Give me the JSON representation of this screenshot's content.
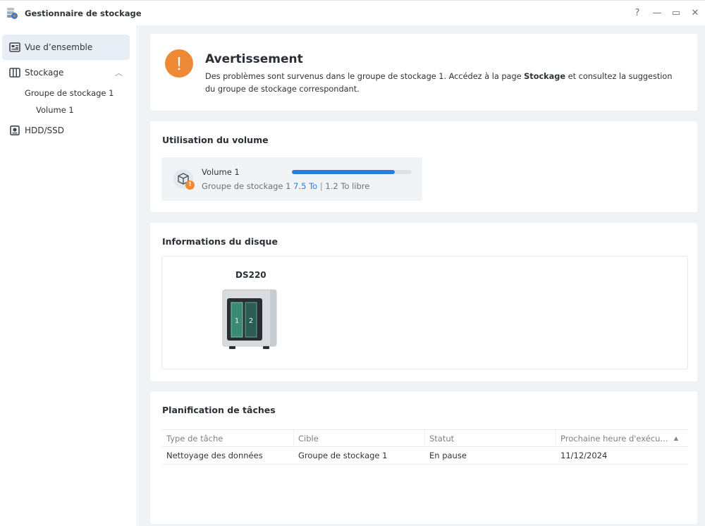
{
  "window": {
    "title": "Gestionnaire de stockage",
    "controls": {
      "help": "?",
      "minimize": "—",
      "maximize": "▭",
      "close": "✕"
    }
  },
  "sidebar": {
    "items": [
      {
        "label": "Vue d’ensemble",
        "icon": "overview-icon",
        "active": true
      },
      {
        "label": "Stockage",
        "icon": "storage-icon",
        "expanded": true
      },
      {
        "label": "HDD/SSD",
        "icon": "disk-icon"
      }
    ],
    "subitems": [
      {
        "label": "Groupe de stockage 1"
      },
      {
        "label": "Volume 1"
      }
    ],
    "chevron": "︿"
  },
  "warning": {
    "title": "Avertissement",
    "text_before": "Des problèmes sont survenus dans le groupe de stockage 1. Accédez à la page ",
    "text_bold": "Stockage",
    "text_after": " et consultez la suggestion du groupe de stockage correspondant.",
    "icon": "!"
  },
  "volume_usage": {
    "title": "Utilisation du volume",
    "volume": {
      "name": "Volume 1",
      "pool": "Groupe de stockage 1",
      "used": "7.5 To",
      "separator": "|",
      "free": "1.2 To libre",
      "usage_fraction": 0.86,
      "badge": "!"
    }
  },
  "disk_info": {
    "title": "Informations du disque",
    "model": "DS220",
    "bays": [
      "1",
      "2"
    ]
  },
  "tasks": {
    "title": "Planification de tâches",
    "columns": [
      "Type de tâche",
      "Cible",
      "Statut",
      "Prochaine heure d'exécu..."
    ],
    "sort_indicator": "▲",
    "rows": [
      [
        "Nettoyage des données",
        "Groupe de stockage 1",
        "En pause",
        "11/12/2024"
      ]
    ]
  },
  "colors": {
    "accent": "#2e7cd9",
    "warning": "#ee8a36",
    "background": "#f0f3f5"
  }
}
